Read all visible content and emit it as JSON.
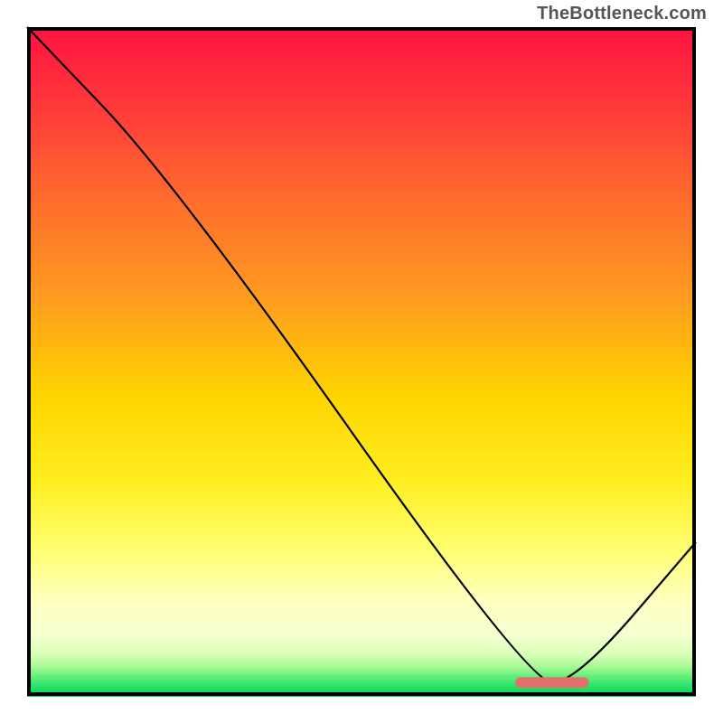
{
  "watermark": "TheBottleneck.com",
  "colors": {
    "top": "#ff1744",
    "mid_upper": "#ff7a2f",
    "mid": "#ffd500",
    "mid_lower": "#ffff66",
    "pale": "#ffffb8",
    "bottom": "#00e060",
    "curve": "#000000",
    "marker": "#e4706d",
    "frame": "#000000"
  },
  "chart_data": {
    "type": "line",
    "title": "",
    "xlabel": "",
    "ylabel": "",
    "xlim": [
      0,
      100
    ],
    "ylim": [
      0,
      100
    ],
    "x": [
      0,
      22,
      75,
      82,
      100
    ],
    "values": [
      100,
      77,
      2,
      2,
      23
    ],
    "marker": {
      "x_start": 73,
      "x_end": 84,
      "y": 2
    },
    "gradient_bands": [
      {
        "y_pct": 0,
        "color": "#ff1240"
      },
      {
        "y_pct": 12,
        "color": "#ff3a3a"
      },
      {
        "y_pct": 25,
        "color": "#ff6a2e"
      },
      {
        "y_pct": 40,
        "color": "#ff9a20"
      },
      {
        "y_pct": 55,
        "color": "#ffd400"
      },
      {
        "y_pct": 68,
        "color": "#ffee20"
      },
      {
        "y_pct": 78,
        "color": "#ffff70"
      },
      {
        "y_pct": 86,
        "color": "#ffffc0"
      },
      {
        "y_pct": 91,
        "color": "#f6ffd0"
      },
      {
        "y_pct": 94,
        "color": "#d8ffb8"
      },
      {
        "y_pct": 96,
        "color": "#a0f890"
      },
      {
        "y_pct": 98,
        "color": "#40e870"
      },
      {
        "y_pct": 100,
        "color": "#00d858"
      }
    ]
  }
}
